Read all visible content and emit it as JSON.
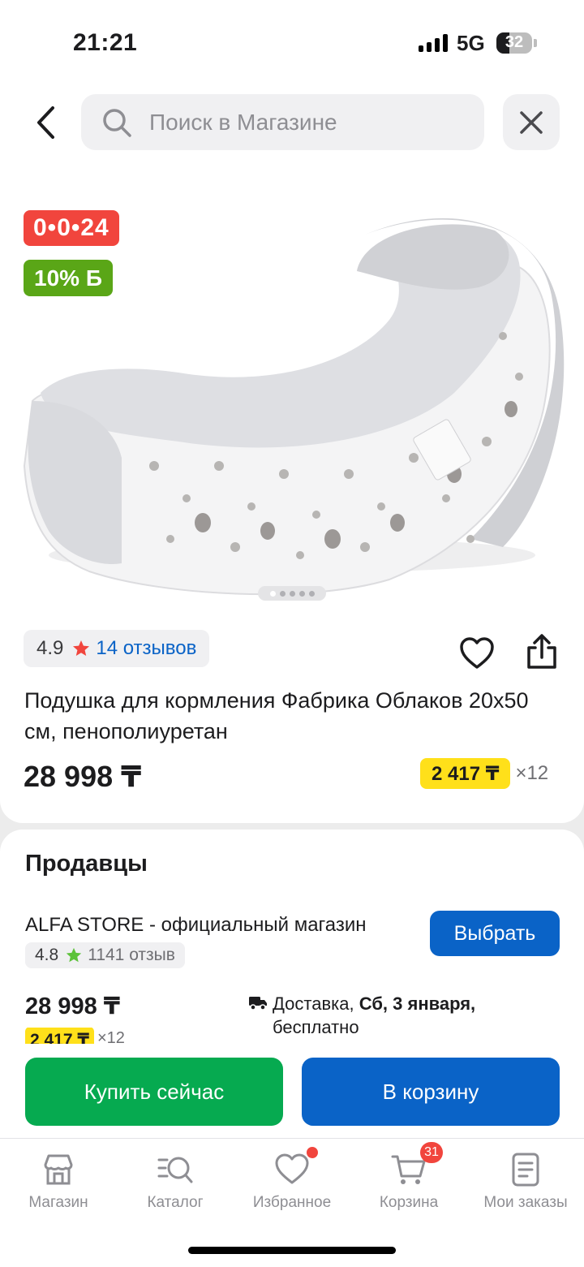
{
  "status_bar": {
    "time": "21:21",
    "network": "5G",
    "battery": "32"
  },
  "search": {
    "placeholder": "Поиск в Магазине"
  },
  "product": {
    "timer": "0•0•24",
    "bonus": "10% Б",
    "rating": "4.9",
    "reviews": "14 отзывов",
    "title": "Подушка для кормления Фабрика Облаков 20х50 см, пенополиуретан",
    "price": "28 998 ₸",
    "installment_amount": "2 417 ₸",
    "installment_times": "×12",
    "image_slides": 5,
    "active_slide": 1
  },
  "sellers": {
    "heading": "Продавцы",
    "items": [
      {
        "name": "ALFA STORE - официальный магазин",
        "rating": "4.8",
        "reviews": "1141 отзыв",
        "choose_label": "Выбрать",
        "price": "28 998 ₸",
        "installment_amount": "2 417 ₸",
        "installment_times": "×12",
        "delivery_prefix": "Доставка,",
        "delivery_date": "Сб, 3 января,",
        "delivery_cost": "бесплатно"
      }
    ]
  },
  "actions": {
    "buy_now": "Купить сейчас",
    "add_to_cart": "В корзину"
  },
  "tab_bar": {
    "items": [
      {
        "label": "Магазин",
        "icon": "store-icon"
      },
      {
        "label": "Каталог",
        "icon": "catalog-search-icon"
      },
      {
        "label": "Избранное",
        "icon": "heart-icon"
      },
      {
        "label": "Корзина",
        "icon": "cart-icon",
        "badge": "31"
      },
      {
        "label": "Мои заказы",
        "icon": "orders-icon"
      }
    ]
  },
  "colors": {
    "accent_blue": "#0a63c7",
    "buy_green": "#06aa50",
    "timer_red": "#f1453d",
    "bonus_green": "#5aa617",
    "installment_yellow": "#ffe01a"
  }
}
